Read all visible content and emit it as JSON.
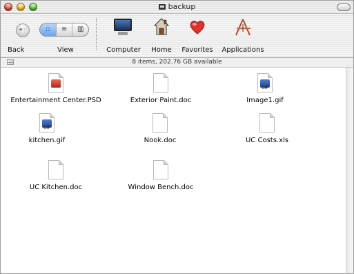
{
  "window": {
    "title": "backup"
  },
  "toolbar": {
    "back_label": "Back",
    "view_label": "View",
    "view_options": [
      "::",
      "≡",
      "▥"
    ],
    "computer_label": "Computer",
    "home_label": "Home",
    "favorites_label": "Favorites",
    "applications_label": "Applications"
  },
  "status": {
    "text": "8 items, 202.76 GB available"
  },
  "files": [
    {
      "name": "Entertainment Center.PSD",
      "icon": "psd-file-icon"
    },
    {
      "name": "Exterior Paint.doc",
      "icon": "document-icon"
    },
    {
      "name": "Image1.gif",
      "icon": "gif-file-icon"
    },
    {
      "name": "kitchen.gif",
      "icon": "gif-file-icon"
    },
    {
      "name": "Nook.doc",
      "icon": "document-icon"
    },
    {
      "name": "UC Costs.xls",
      "icon": "document-icon"
    },
    {
      "name": "UC Kitchen.doc",
      "icon": "document-icon"
    },
    {
      "name": "Window Bench.doc",
      "icon": "document-icon"
    }
  ],
  "badges": {
    "psd": "",
    "gif": "GIF"
  }
}
